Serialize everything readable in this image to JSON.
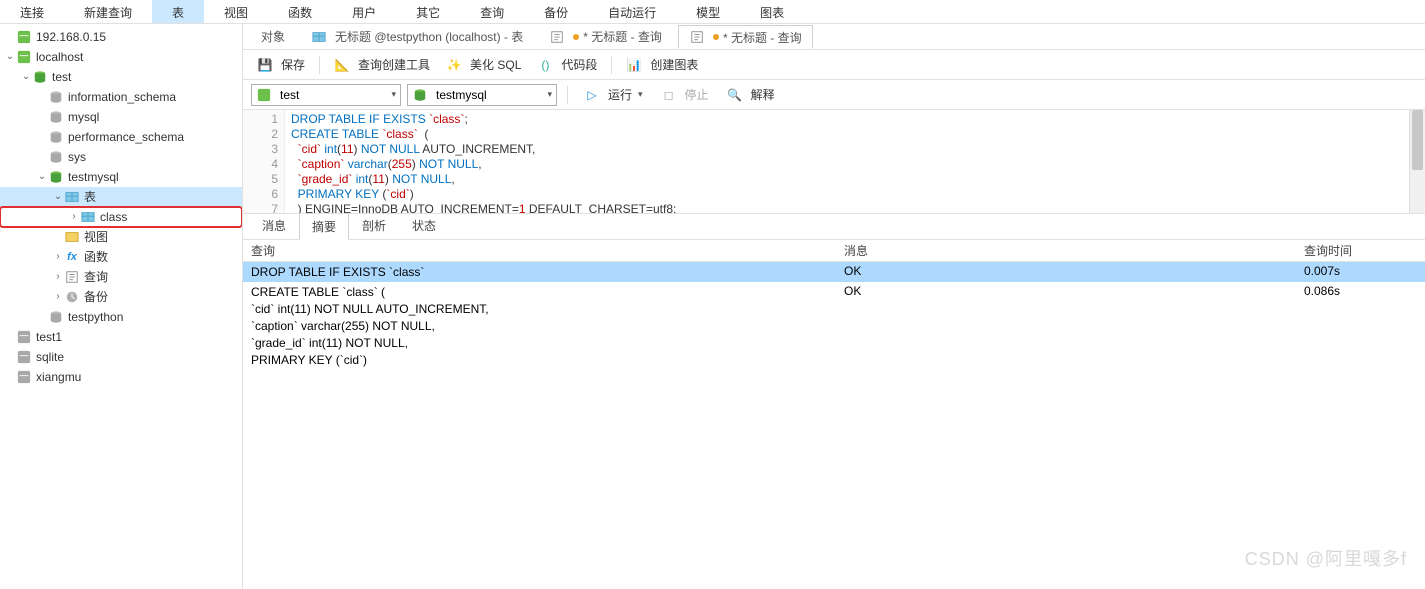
{
  "menu": [
    "连接",
    "新建查询",
    "表",
    "视图",
    "函数",
    "用户",
    "其它",
    "查询",
    "备份",
    "自动运行",
    "模型",
    "图表"
  ],
  "menu_active": 2,
  "tree": {
    "conns": [
      {
        "name": "192.168.0.15",
        "type": "server-green"
      },
      {
        "name": "localhost",
        "type": "server-green",
        "expand": "v",
        "children": [
          {
            "name": "test",
            "type": "db-green",
            "expand": "v",
            "children": [
              {
                "name": "information_schema",
                "type": "db-grey"
              },
              {
                "name": "mysql",
                "type": "db-grey"
              },
              {
                "name": "performance_schema",
                "type": "db-grey"
              },
              {
                "name": "sys",
                "type": "db-grey"
              },
              {
                "name": "testmysql",
                "type": "db-green",
                "expand": "v",
                "children": [
                  {
                    "name": "表",
                    "type": "table",
                    "expand": "v",
                    "sel": true,
                    "children": [
                      {
                        "name": "class",
                        "type": "table",
                        "expand": ">",
                        "hl": true
                      }
                    ]
                  },
                  {
                    "name": "视图",
                    "type": "view"
                  },
                  {
                    "name": "函数",
                    "type": "fx",
                    "expand": ">"
                  },
                  {
                    "name": "查询",
                    "type": "query",
                    "expand": ">"
                  },
                  {
                    "name": "备份",
                    "type": "backup",
                    "expand": ">"
                  }
                ]
              },
              {
                "name": "testpython",
                "type": "db-grey"
              }
            ]
          },
          {
            "name": "test1",
            "type": "server-grey"
          },
          {
            "name": "sqlite",
            "type": "server-grey"
          },
          {
            "name": "xiangmu",
            "type": "server-grey"
          }
        ]
      }
    ]
  },
  "tabs": [
    {
      "label": "对象"
    },
    {
      "label": "无标题 @testpython (localhost) - 表",
      "icon": "table",
      "dot": null
    },
    {
      "label": "* 无标题 - 查询",
      "icon": "query",
      "dot": "#f0a020"
    },
    {
      "label": "* 无标题 - 查询",
      "icon": "query",
      "dot": "#f0a020",
      "active": true
    }
  ],
  "toolbar": {
    "save": "保存",
    "qb": "查询创建工具",
    "beautify": "美化 SQL",
    "snippet": "代码段",
    "chart": "创建图表"
  },
  "combos": {
    "conn": "test",
    "db": "testmysql"
  },
  "runbar": {
    "run": "运行",
    "stop": "停止",
    "explain": "解释"
  },
  "sql_lines": [
    {
      "n": 1,
      "html": "<span class='kw'>DROP</span> <span class='kw'>TABLE</span> <span class='kw'>IF</span> <span class='kw'>EXISTS</span> <span class='str'>`class`</span>;"
    },
    {
      "n": 2,
      "html": "<span class='kw'>CREATE</span> <span class='kw'>TABLE</span> <span class='str'>`class`</span>  (",
      "fold": "⊟"
    },
    {
      "n": 3,
      "html": "  <span class='str'>`cid`</span> <span class='typ'>int</span>(<span class='str'>11</span>) <span class='kw'>NOT</span> <span class='kw'>NULL</span> AUTO_INCREMENT,"
    },
    {
      "n": 4,
      "html": "  <span class='str'>`caption`</span> <span class='typ'>varchar</span>(<span class='str'>255</span>) <span class='kw'>NOT</span> <span class='kw'>NULL</span>,"
    },
    {
      "n": 5,
      "html": "  <span class='str'>`grade_id`</span> <span class='typ'>int</span>(<span class='str'>11</span>) <span class='kw'>NOT</span> <span class='kw'>NULL</span>,"
    },
    {
      "n": 6,
      "html": "  <span class='kw'>PRIMARY</span> <span class='kw'>KEY</span> (<span class='str'>`cid`</span>)",
      "fold": "⊢"
    },
    {
      "n": 7,
      "html": "  ) ENGINE=InnoDB AUTO_INCREMENT=<span class='str'>1</span> DEFAULT_CHARSET=utf8;"
    }
  ],
  "rtabs": [
    "消息",
    "摘要",
    "剖析",
    "状态"
  ],
  "rtab_active": 1,
  "rcols": {
    "q": "查询",
    "m": "消息",
    "t": "查询时间"
  },
  "rows": [
    {
      "q": "DROP TABLE IF EXISTS `class`",
      "m": "OK",
      "t": "0.007s",
      "sel": true
    },
    {
      "q": "CREATE TABLE `class`  (\n`cid` int(11) NOT NULL AUTO_INCREMENT,\n`caption` varchar(255) NOT NULL,\n`grade_id` int(11) NOT NULL,\nPRIMARY KEY (`cid`)",
      "m": "OK",
      "t": "0.086s"
    }
  ],
  "watermark": "CSDN @阿里嘎多f"
}
